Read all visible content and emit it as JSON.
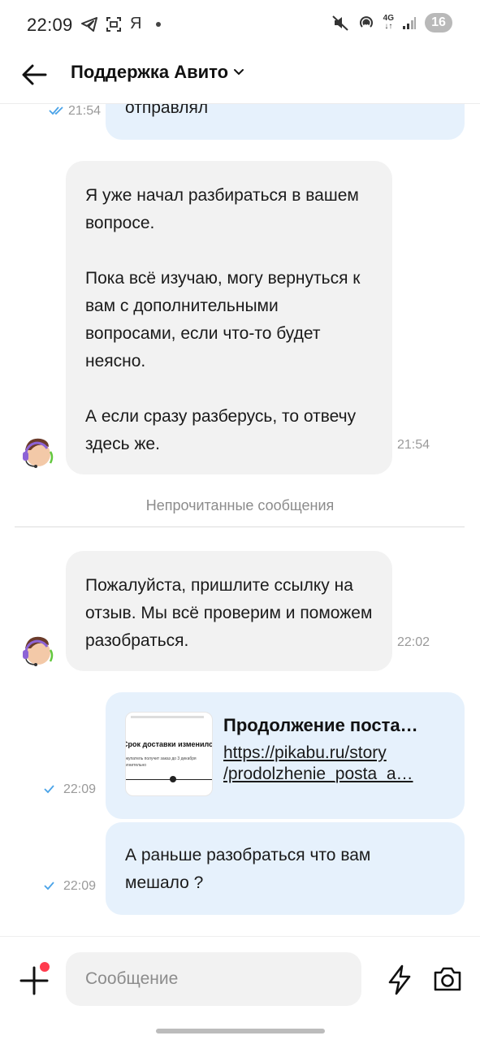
{
  "status_bar": {
    "time": "22:09",
    "left_icons": [
      "telegram-icon",
      "screenshot-icon",
      "yandex-icon",
      "dot-icon"
    ],
    "yandex_letter": "Я",
    "network": "4G",
    "battery": "16"
  },
  "header": {
    "title": "Поддержка Авито"
  },
  "messages": [
    {
      "direction": "out",
      "text": "отправлял",
      "time": "21:54",
      "status": "read"
    },
    {
      "direction": "in",
      "paragraphs": [
        "Я уже начал разбираться в вашем вопросе.",
        "Пока всё изучаю, могу вернуться к вам с дополнительными вопросами, если что-то будет неясно.",
        "А если сразу разберусь, то отвечу здесь же."
      ],
      "time": "21:54"
    },
    {
      "direction": "in",
      "paragraphs": [
        "Пожалуйста, пришлите ссылку на отзыв. Мы всё проверим и поможем разобраться."
      ],
      "time": "22:02"
    },
    {
      "direction": "out",
      "link": {
        "title": "Продолжение поста…",
        "url_line1": "https://pikabu.ru/story",
        "url_line2": "/prodolzhenie_posta_a…",
        "thumb_heading": "Срок доставки изменился",
        "thumb_text": "окупатель получит заказ до 3 декабря",
        "thumb_text2": "олнительно"
      },
      "time": "22:09",
      "status": "sent"
    },
    {
      "direction": "out",
      "text": "А раньше разобраться что вам мешало ?",
      "time": "22:09",
      "status": "sent"
    }
  ],
  "unread_divider": "Непрочитанные сообщения",
  "composer": {
    "placeholder": "Сообщение"
  },
  "colors": {
    "incoming_bubble": "#f2f2f2",
    "outgoing_bubble": "#e6f1fc",
    "tick": "#4aa3e8",
    "notification_dot": "#ff3b4e"
  }
}
